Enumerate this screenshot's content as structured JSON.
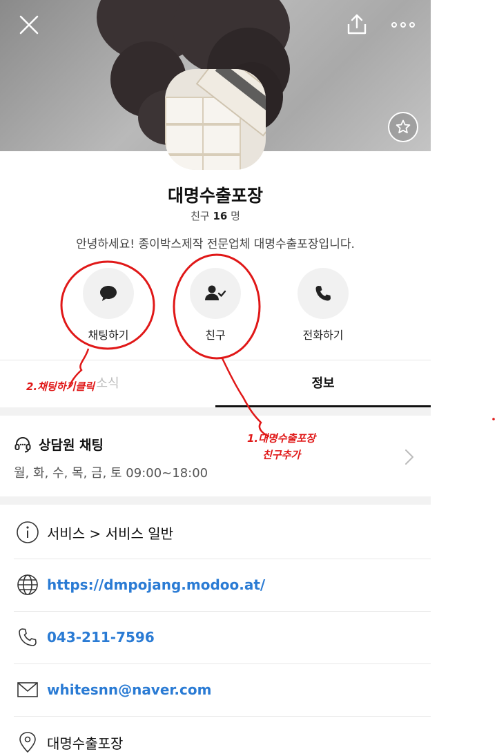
{
  "profile": {
    "name": "대명수출포장",
    "friends_label": "친구",
    "friends_count": "16",
    "friends_unit": "명",
    "description": "안녕하세요! 종이박스제작 전문업체 대명수출포장입니다."
  },
  "actions": [
    {
      "label": "채팅하기",
      "icon": "chat-bubble-icon"
    },
    {
      "label": "친구",
      "icon": "person-check-icon"
    },
    {
      "label": "전화하기",
      "icon": "phone-icon"
    }
  ],
  "tabs": {
    "news": "소식",
    "info": "정보"
  },
  "chat": {
    "title": "상담원 채팅",
    "hours": "월, 화, 수, 목, 금, 토  09:00~18:00"
  },
  "info_rows": [
    {
      "icon": "info-icon",
      "text": "서비스 > 서비스 일반"
    },
    {
      "icon": "globe-icon",
      "text": "https://dmpojang.modoo.at/"
    },
    {
      "icon": "phone-icon",
      "text": "043-211-7596"
    },
    {
      "icon": "mail-icon",
      "text": "whitesnn@naver.com"
    },
    {
      "icon": "location-pin-icon",
      "text": "대명수출포장"
    }
  ],
  "annotations": {
    "step1_line1": "1.대명수출포장",
    "step1_line2": "친구추가",
    "step2": "2.채팅하기클릭"
  },
  "colors": {
    "link": "#2a7bd4",
    "annotation": "#e01818"
  }
}
